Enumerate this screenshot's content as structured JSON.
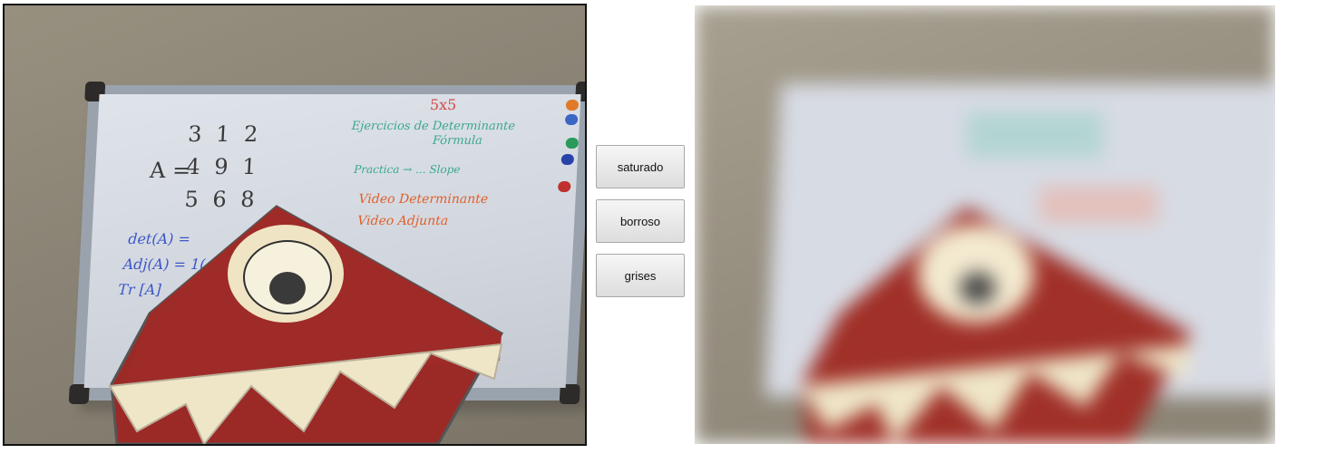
{
  "buttons": [
    {
      "id": "saturado",
      "label": "saturado"
    },
    {
      "id": "borroso",
      "label": "borroso"
    },
    {
      "id": "grises",
      "label": "grises"
    }
  ],
  "board_text": {
    "matrix_label": "A =",
    "matrix_rows": [
      "3  1  2",
      "4  9  1",
      "5  6  8"
    ],
    "title_red": "5x5",
    "green_line_1": "Ejercicios de Determinante",
    "green_line_2": "Fórmula",
    "green_line_3": "Practica  →  ... Slope",
    "orange_line_1": "Video Determinante",
    "orange_line_2": "Video Adjunta",
    "blue_line_1": "det(A) =",
    "blue_line_2": "Adj(A) = 1(",
    "blue_line_3": "Tr [A]"
  },
  "colors": {
    "frame_border": "#111111",
    "whiteboard": "#d9dde4",
    "monster_red": "#9b2a26",
    "monster_teeth": "#efe6c8",
    "ink_green": "#3aa889",
    "ink_red": "#d44a4a",
    "ink_orange": "#e0602d",
    "ink_blue": "#3b56c9",
    "ink_black": "#3a3a3a"
  },
  "left_panel": {
    "kind": "live-video-frame"
  },
  "right_panel": {
    "kind": "processed-canvas",
    "effect": "blur"
  }
}
